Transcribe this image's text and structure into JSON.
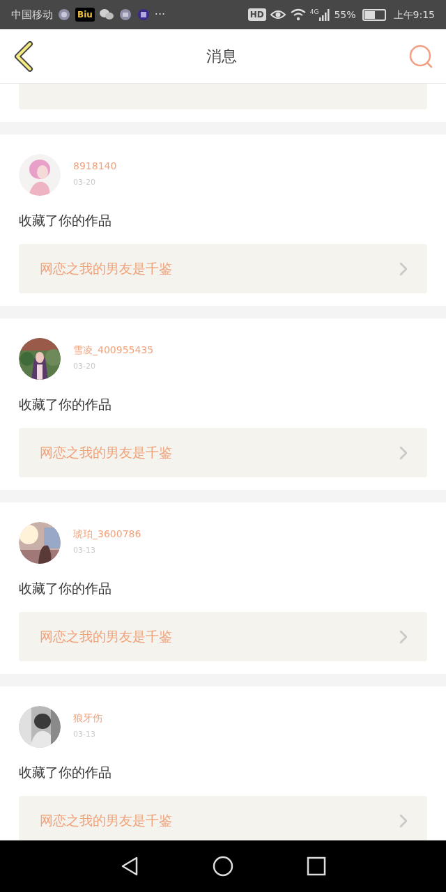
{
  "status_bar": {
    "carrier": "中国移动",
    "app_badge": "Biu",
    "more": "···",
    "hd": "HD",
    "network": "4G",
    "battery": "55%",
    "time": "上午9:15"
  },
  "header": {
    "title": "消息"
  },
  "messages": [
    {
      "user": "8918140",
      "date": "03-20",
      "action": "收藏了你的作品",
      "work": "网恋之我的男友是千鉴"
    },
    {
      "user": "雪凌_400955435",
      "date": "03-20",
      "action": "收藏了你的作品",
      "work": "网恋之我的男友是千鉴"
    },
    {
      "user": "琥珀_3600786",
      "date": "03-13",
      "action": "收藏了你的作品",
      "work": "网恋之我的男友是千鉴"
    },
    {
      "user": "狼牙伤",
      "date": "03-13",
      "action": "收藏了你的作品",
      "work": "网恋之我的男友是千鉴"
    }
  ]
}
